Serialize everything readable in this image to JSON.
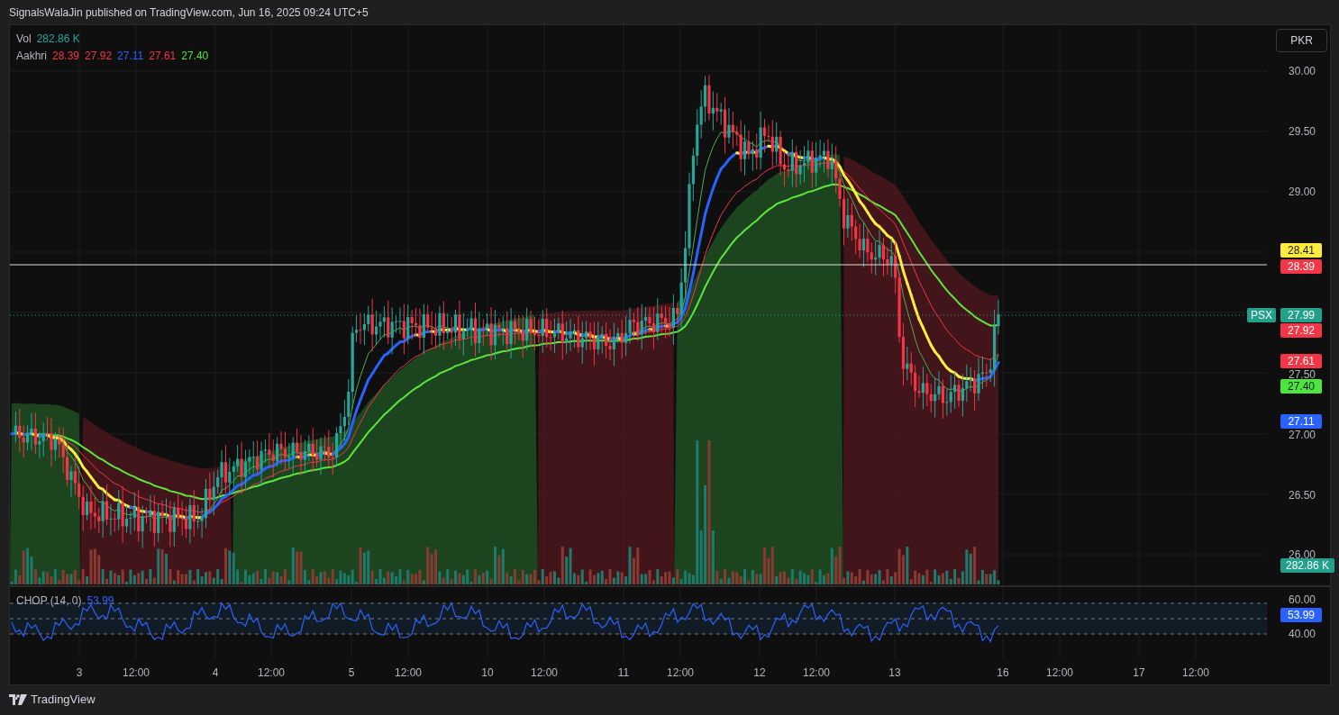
{
  "header": {
    "text": "SignalsWalaJin published on TradingView.com, Jun 16, 2025 09:24 UTC+5"
  },
  "currency_button": {
    "label": "PKR"
  },
  "legend": [
    {
      "label": "Vol",
      "values": [
        {
          "text": "282.86 K",
          "color": "#26a69a"
        }
      ]
    },
    {
      "label": "Aakhri",
      "values": [
        {
          "text": "28.39",
          "color": "#f23645"
        },
        {
          "text": "27.92",
          "color": "#f23645"
        },
        {
          "text": "27.11",
          "color": "#2962ff"
        },
        {
          "text": "27.61",
          "color": "#f23645"
        },
        {
          "text": "27.40",
          "color": "#4ce63c"
        }
      ]
    }
  ],
  "price_axis": {
    "ticks": [
      "30.00",
      "29.50",
      "29.00",
      "27.50",
      "27.00",
      "26.50",
      "26.00"
    ],
    "badges": [
      {
        "text": "28.41",
        "color": "#ffeb3b"
      },
      {
        "text": "28.39",
        "color": "#f23645"
      },
      {
        "text": "27.99",
        "color": "#22a08a"
      },
      {
        "text": "27.92",
        "color": "#f23645"
      },
      {
        "text": "27.61",
        "color": "#f23645"
      },
      {
        "text": "27.40",
        "color": "#4ce63c"
      },
      {
        "text": "27.11",
        "color": "#2962ff"
      },
      {
        "text": "282.86 K",
        "color": "#22a08a"
      }
    ],
    "symbol_tag": {
      "text": "PSX",
      "color": "#22a08a"
    }
  },
  "chop": {
    "label": "CHOP (14, 0)",
    "value": "53.99",
    "ticks": [
      "60.00",
      "40.00"
    ],
    "badge": {
      "text": "53.99",
      "color": "#2962ff"
    }
  },
  "time_axis": [
    "3",
    "12:00",
    "4",
    "12:00",
    "5",
    "12:00",
    "10",
    "12:00",
    "11",
    "12:00",
    "12",
    "12:00",
    "13",
    "16",
    "12:00",
    "17",
    "12:00"
  ],
  "footer": {
    "brand": "TradingView"
  }
}
